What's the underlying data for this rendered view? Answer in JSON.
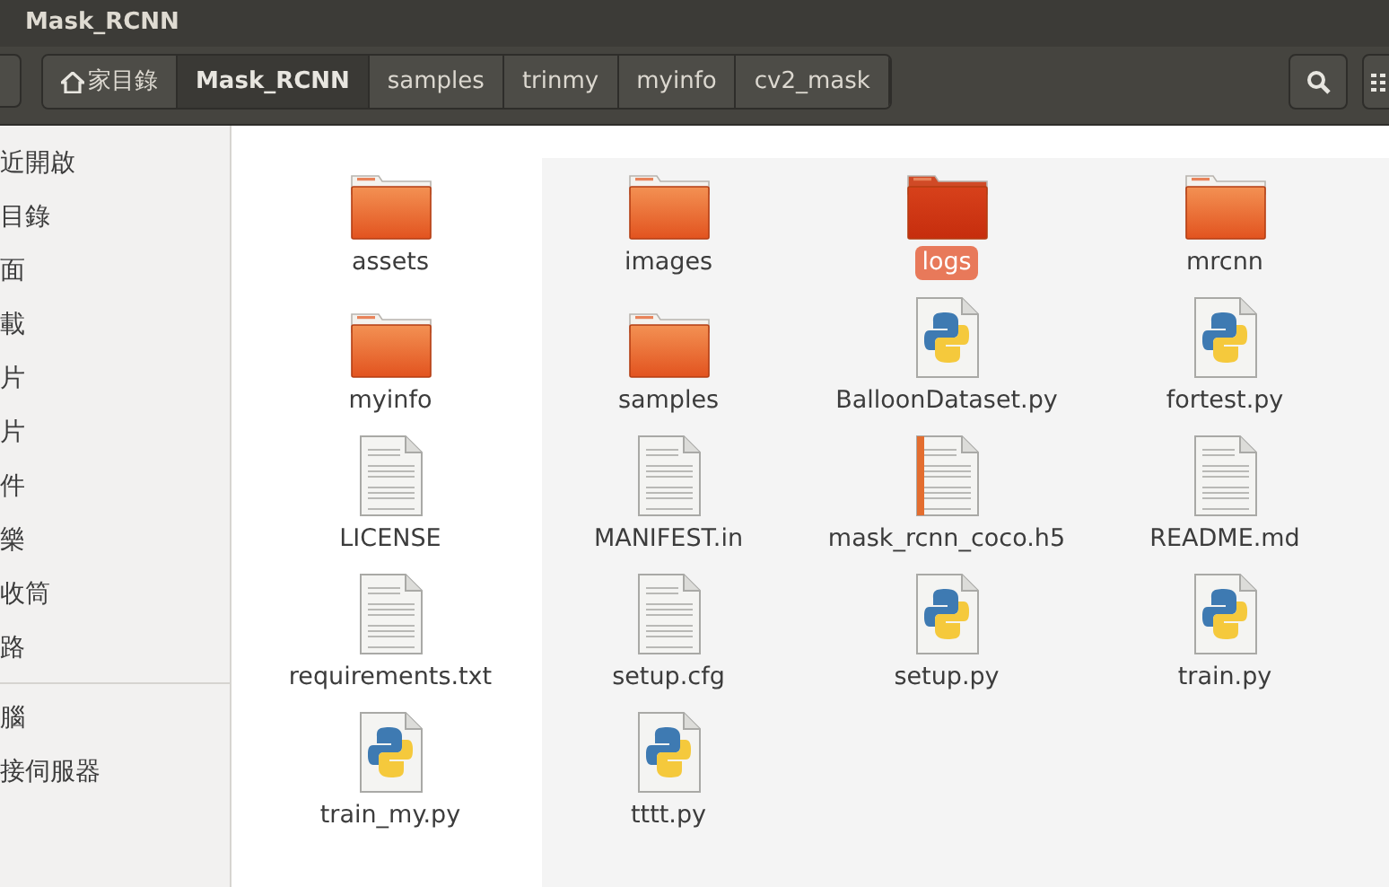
{
  "window": {
    "title": "Mask_RCNN"
  },
  "breadcrumb": [
    {
      "label": "家目錄",
      "kind": "home",
      "selected": false
    },
    {
      "label": "Mask_RCNN",
      "kind": "dir",
      "selected": true
    },
    {
      "label": "samples",
      "kind": "dir",
      "selected": false
    },
    {
      "label": "trinmy",
      "kind": "dir",
      "selected": false
    },
    {
      "label": "myinfo",
      "kind": "dir",
      "selected": false
    },
    {
      "label": "cv2_mask",
      "kind": "dir",
      "selected": false
    }
  ],
  "sidebar": {
    "items": [
      {
        "label": "近開啟"
      },
      {
        "label": "目錄"
      },
      {
        "label": "面"
      },
      {
        "label": "載"
      },
      {
        "label": "片"
      },
      {
        "label": "片"
      },
      {
        "label": "件"
      },
      {
        "label": "樂"
      },
      {
        "label": "收筒"
      },
      {
        "label": "路"
      },
      {
        "label": "腦",
        "separator_before": true
      },
      {
        "label": "接伺服器"
      }
    ]
  },
  "files": [
    {
      "name": "assets",
      "kind": "folder",
      "selected": false
    },
    {
      "name": "images",
      "kind": "folder",
      "selected": false
    },
    {
      "name": "logs",
      "kind": "folder",
      "selected": true
    },
    {
      "name": "mrcnn",
      "kind": "folder",
      "selected": false
    },
    {
      "name": "myinfo",
      "kind": "folder",
      "selected": false
    },
    {
      "name": "samples",
      "kind": "folder",
      "selected": false
    },
    {
      "name": "BalloonDataset.py",
      "kind": "python",
      "selected": false
    },
    {
      "name": "fortest.py",
      "kind": "python",
      "selected": false
    },
    {
      "name": "LICENSE",
      "kind": "text",
      "selected": false
    },
    {
      "name": "MANIFEST.in",
      "kind": "text",
      "selected": false
    },
    {
      "name": "mask_rcnn_coco.h5",
      "kind": "archive",
      "selected": false
    },
    {
      "name": "README.md",
      "kind": "text",
      "selected": false
    },
    {
      "name": "requirements.txt",
      "kind": "text",
      "selected": false
    },
    {
      "name": "setup.cfg",
      "kind": "text",
      "selected": false
    },
    {
      "name": "setup.py",
      "kind": "python",
      "selected": false
    },
    {
      "name": "train.py",
      "kind": "python",
      "selected": false
    },
    {
      "name": "train_my.py",
      "kind": "python",
      "selected": false
    },
    {
      "name": "tttt.py",
      "kind": "python",
      "selected": false
    }
  ]
}
